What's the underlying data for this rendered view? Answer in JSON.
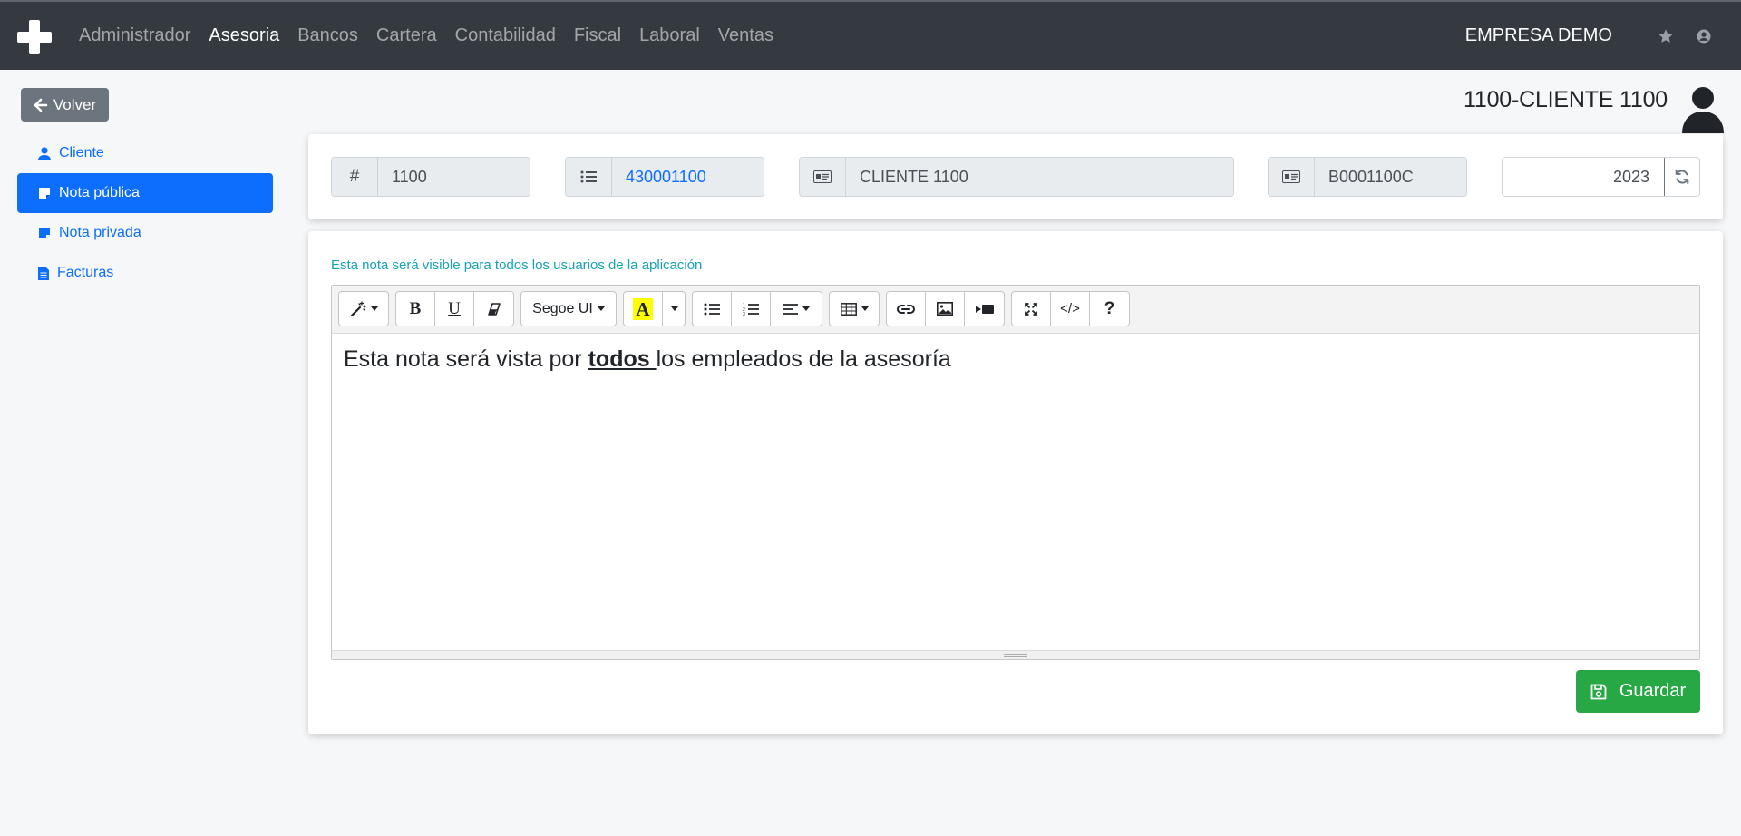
{
  "navbar": {
    "menu": [
      "Administrador",
      "Asesoria",
      "Bancos",
      "Cartera",
      "Contabilidad",
      "Fiscal",
      "Laboral",
      "Ventas"
    ],
    "active_menu": "Asesoria",
    "company": "EMPRESA DEMO"
  },
  "sidebar": {
    "back_label": "Volver",
    "items": [
      {
        "label": "Cliente",
        "icon": "user-icon"
      },
      {
        "label": "Nota pública",
        "icon": "note-icon",
        "active": true
      },
      {
        "label": "Nota privada",
        "icon": "note-icon"
      },
      {
        "label": "Facturas",
        "icon": "file-icon"
      }
    ]
  },
  "client": {
    "title": "1100-CLIENTE 1100"
  },
  "fields": {
    "code_addon": "#",
    "code": "1100",
    "account": "430001100",
    "name": "CLIENTE 1100",
    "tax_id": "B0001100C",
    "year": "2023"
  },
  "note": {
    "hint": "Esta nota será visible para todos los usuarios de la aplicación",
    "text_before": "Esta nota será vista por ",
    "text_bold": "todos ",
    "text_after": "los empleados de la asesoría"
  },
  "toolbar": {
    "font_name": "Segoe UI",
    "code_label": "</>",
    "help_label": "?",
    "bold_label": "B",
    "underline_label": "U",
    "color_label": "A"
  },
  "actions": {
    "save_label": "Guardar"
  },
  "colors": {
    "navbar": "#343a40",
    "primary": "#0d6efd",
    "success": "#28a745",
    "secondary": "#6c757d",
    "hint": "#17a2b8"
  }
}
